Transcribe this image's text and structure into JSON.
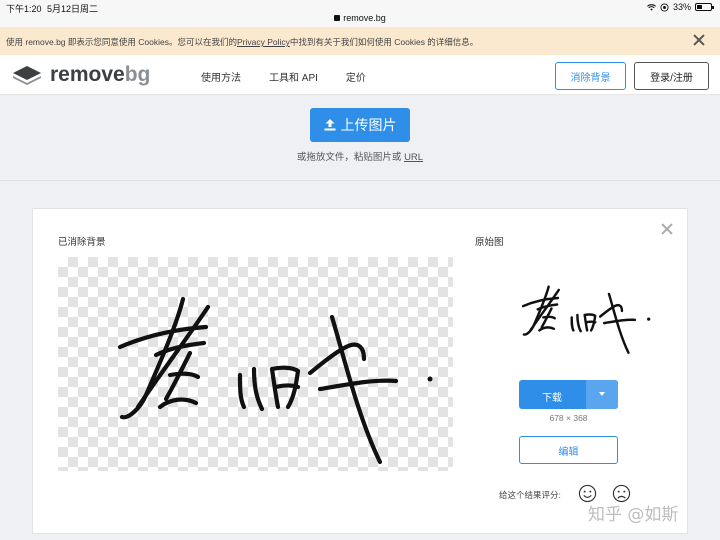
{
  "statusbar": {
    "time": "下午1:20",
    "date": "5月12日周二",
    "url": "remove.bg",
    "battery": "33%"
  },
  "cookie": {
    "text_before": "使用 remove.bg 即表示您同意使用 Cookies。您可以在我们的",
    "link": "Privacy Policy",
    "text_after": "中找到有关于我们如何使用 Cookies 的详细信息。"
  },
  "navbar": {
    "logo_main": "remove",
    "logo_suffix": "bg",
    "links": [
      "使用方法",
      "工具和 API",
      "定价"
    ],
    "remove_bg_button": "消除背景",
    "login_button": "登录/注册"
  },
  "upload": {
    "button_label": "上传图片",
    "hint_text": "或拖放文件，粘贴图片或 ",
    "hint_link": "URL"
  },
  "result": {
    "removed_label": "已消除背景",
    "original_label": "原始图",
    "download_label": "下载",
    "dimensions": "678 × 368",
    "edit_label": "编辑",
    "rate_label": "给这个结果评分:"
  },
  "watermark": "知乎 @如斯",
  "colors": {
    "accent": "#2f8fe8",
    "cookie_bg": "#fbe9cf",
    "page_bg": "#eef0f4"
  }
}
